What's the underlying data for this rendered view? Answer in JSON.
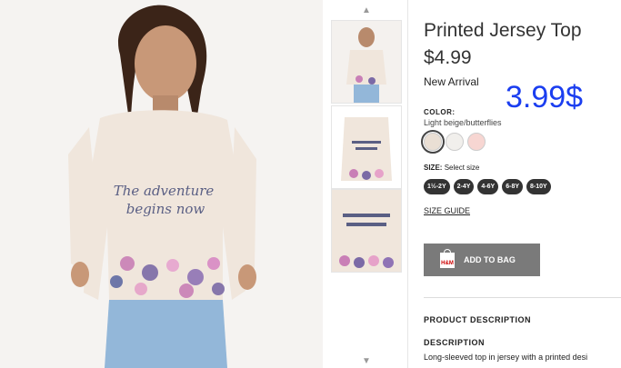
{
  "product": {
    "title": "Printed Jersey Top",
    "price": "$4.99",
    "badge": "New Arrival",
    "overlay_price": "3.99$"
  },
  "color": {
    "label": "COLOR:",
    "value": "Light beige/butterflies",
    "swatches": [
      "#eadfd4",
      "#f1efec",
      "#f7d6d2"
    ]
  },
  "size": {
    "label": "SIZE:",
    "select_text": "Select size",
    "options": [
      "1½-2Y",
      "2-4Y",
      "4-6Y",
      "6-8Y",
      "8-10Y"
    ],
    "guide": "SIZE GUIDE"
  },
  "actions": {
    "add_to_bag": "ADD TO BAG",
    "bag_logo": "H&M"
  },
  "description": {
    "section_title": "PRODUCT DESCRIPTION",
    "heading": "DESCRIPTION",
    "text": "Long-sleeved top in jersey with a printed desi"
  },
  "shirt_print": {
    "line1": "The adventure",
    "line2": "begins now"
  },
  "colors": {
    "accent_price": "#1b3ef0",
    "button": "#7a7a7a",
    "shirt": "#f0e6dc"
  }
}
